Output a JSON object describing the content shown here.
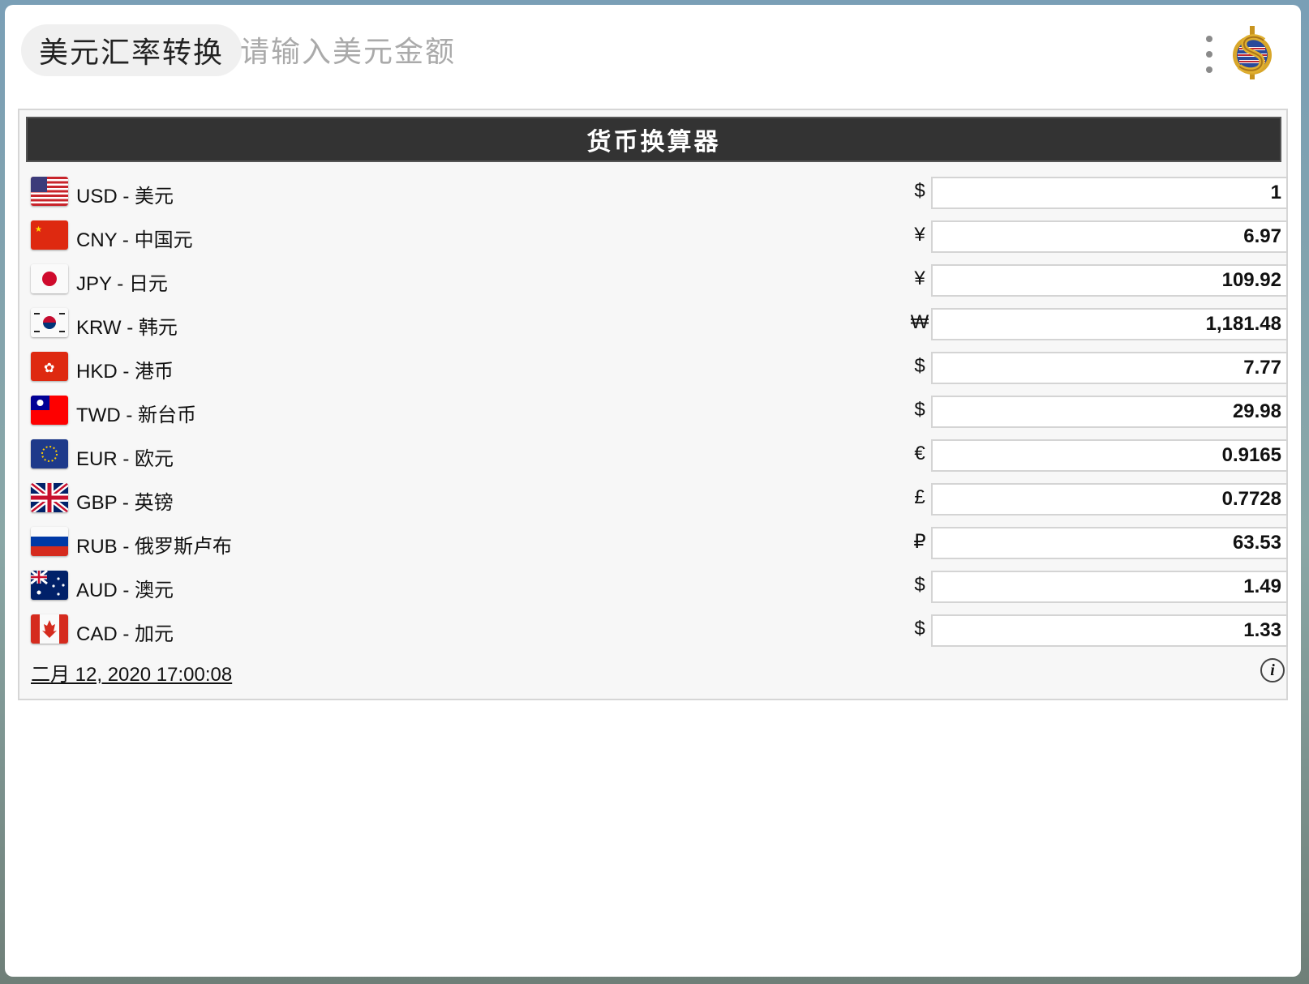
{
  "header": {
    "title": "美元汇率转换",
    "input_placeholder": "请输入美元金额",
    "more_icon": "more-vertical-icon",
    "logo_icon": "dollar-logo-icon"
  },
  "converter": {
    "title": "货币换算器",
    "rows": [
      {
        "label": "USD - 美元",
        "symbol": "$",
        "value": "1",
        "flag": "us-flag-icon"
      },
      {
        "label": "CNY - 中国元",
        "symbol": "¥",
        "value": "6.97",
        "flag": "cn-flag-icon"
      },
      {
        "label": "JPY - 日元",
        "symbol": "¥",
        "value": "109.92",
        "flag": "jp-flag-icon"
      },
      {
        "label": "KRW - 韩元",
        "symbol": "₩",
        "value": "1,181.48",
        "flag": "kr-flag-icon"
      },
      {
        "label": "HKD - 港币",
        "symbol": "$",
        "value": "7.77",
        "flag": "hk-flag-icon"
      },
      {
        "label": "TWD - 新台币",
        "symbol": "$",
        "value": "29.98",
        "flag": "tw-flag-icon"
      },
      {
        "label": "EUR - 欧元",
        "symbol": "€",
        "value": "0.9165",
        "flag": "eu-flag-icon"
      },
      {
        "label": "GBP - 英镑",
        "symbol": "£",
        "value": "0.7728",
        "flag": "gb-flag-icon"
      },
      {
        "label": "RUB - 俄罗斯卢布",
        "symbol": "₽",
        "value": "63.53",
        "flag": "ru-flag-icon"
      },
      {
        "label": "AUD - 澳元",
        "symbol": "$",
        "value": "1.49",
        "flag": "au-flag-icon"
      },
      {
        "label": "CAD - 加元",
        "symbol": "$",
        "value": "1.33",
        "flag": "ca-flag-icon"
      }
    ],
    "timestamp": "二月 12, 2020 17:00:08",
    "info_icon": "info-icon"
  },
  "colors": {
    "header_bar": "#333333",
    "panel_bg": "#f7f7f7",
    "placeholder": "#aaaaaa"
  }
}
